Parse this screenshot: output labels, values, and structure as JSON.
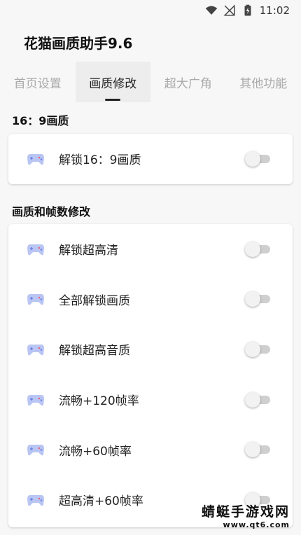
{
  "status_bar": {
    "time": "11:02"
  },
  "app": {
    "title": "花猫画质助手9.6"
  },
  "tabs": [
    {
      "label": "首页设置",
      "active": false
    },
    {
      "label": "画质修改",
      "active": true
    },
    {
      "label": "超大广角",
      "active": false
    },
    {
      "label": "其他功能",
      "active": false
    }
  ],
  "sections": [
    {
      "title": "16：9画质",
      "items": [
        {
          "label": "解锁16：9画质",
          "enabled": false
        }
      ]
    },
    {
      "title": "画质和帧数修改",
      "items": [
        {
          "label": "解锁超高清",
          "enabled": false
        },
        {
          "label": "全部解锁画质",
          "enabled": false
        },
        {
          "label": "解锁超高音质",
          "enabled": false
        },
        {
          "label": "流畅+120帧率",
          "enabled": false
        },
        {
          "label": "流畅+60帧率",
          "enabled": false
        },
        {
          "label": "超高清+60帧率",
          "enabled": false
        }
      ]
    }
  ],
  "watermark": {
    "name": "蜻蜓手游戏网",
    "url": "www.qt6.com"
  },
  "colors": {
    "background": "#f7f7f7",
    "active_tab_bg": "#ededed",
    "inactive_tab_text": "#aaaaaa",
    "switch_track_off": "#cfcfcf",
    "gamepad_icon": "#7e93ea"
  },
  "icons": {
    "row_icon": "gamepad-icon",
    "status": [
      "wifi-icon",
      "no-signal-icon",
      "battery-charging-icon"
    ]
  }
}
